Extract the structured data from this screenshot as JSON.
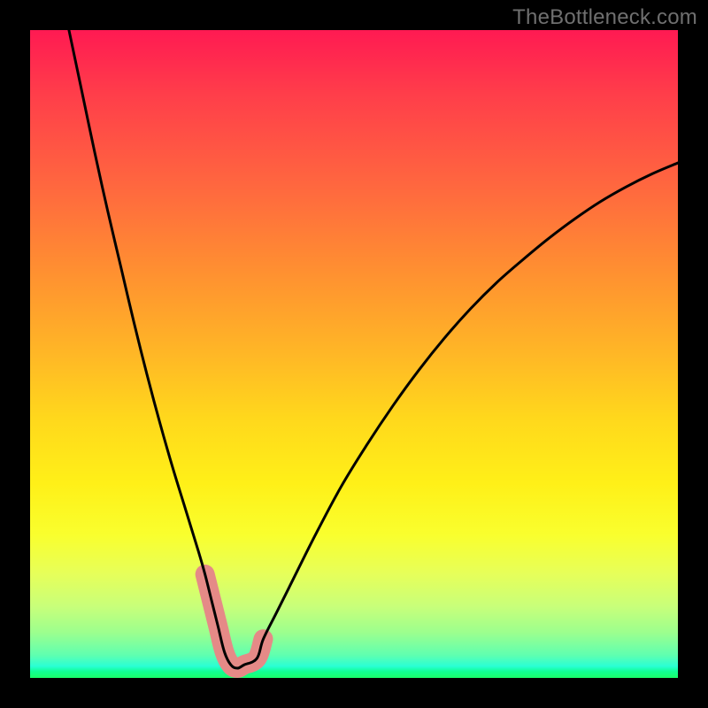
{
  "watermark": {
    "text": "TheBottleneck.com"
  },
  "chart_data": {
    "type": "line",
    "title": "",
    "xlabel": "",
    "ylabel": "",
    "xlim": [
      0,
      100
    ],
    "ylim": [
      0,
      100
    ],
    "grid": false,
    "legend": false,
    "annotations": [],
    "series": [
      {
        "name": "bottleneck-curve",
        "color": "#000000",
        "x": [
          6,
          8,
          10,
          12,
          14,
          16,
          18,
          20,
          22,
          24,
          26,
          27,
          28,
          29,
          30,
          31,
          32,
          33,
          35,
          36,
          38,
          40,
          44,
          48,
          52,
          56,
          60,
          64,
          68,
          72,
          76,
          80,
          84,
          88,
          92,
          96,
          100
        ],
        "y": [
          100,
          90.5,
          81,
          72,
          63.5,
          55,
          47,
          39.5,
          32.5,
          26,
          19.5,
          16,
          12,
          8,
          4,
          2,
          1.5,
          2,
          3,
          6,
          10,
          14,
          22,
          29.5,
          36,
          42,
          47.5,
          52.5,
          57,
          61,
          64.5,
          67.8,
          70.8,
          73.5,
          75.8,
          77.8,
          79.5
        ]
      },
      {
        "name": "highlight-region",
        "color": "#e58a87",
        "x": [
          27,
          28,
          29,
          30,
          31,
          32,
          33,
          35,
          36
        ],
        "y": [
          16,
          12,
          8,
          4,
          2,
          1.5,
          2,
          3,
          6
        ]
      }
    ],
    "gradient_stops": [
      {
        "pos": 0,
        "color": "#ff1a52"
      },
      {
        "pos": 0.1,
        "color": "#ff3e4a"
      },
      {
        "pos": 0.25,
        "color": "#ff6a3e"
      },
      {
        "pos": 0.38,
        "color": "#ff9230"
      },
      {
        "pos": 0.5,
        "color": "#ffb726"
      },
      {
        "pos": 0.6,
        "color": "#ffd81c"
      },
      {
        "pos": 0.7,
        "color": "#fff018"
      },
      {
        "pos": 0.78,
        "color": "#f9ff2e"
      },
      {
        "pos": 0.84,
        "color": "#e6ff5a"
      },
      {
        "pos": 0.89,
        "color": "#c8ff7a"
      },
      {
        "pos": 0.93,
        "color": "#9cff8e"
      },
      {
        "pos": 0.965,
        "color": "#5fffb0"
      },
      {
        "pos": 0.982,
        "color": "#2affd4"
      },
      {
        "pos": 0.99,
        "color": "#11ff94"
      },
      {
        "pos": 1.0,
        "color": "#1aff6a"
      }
    ]
  }
}
